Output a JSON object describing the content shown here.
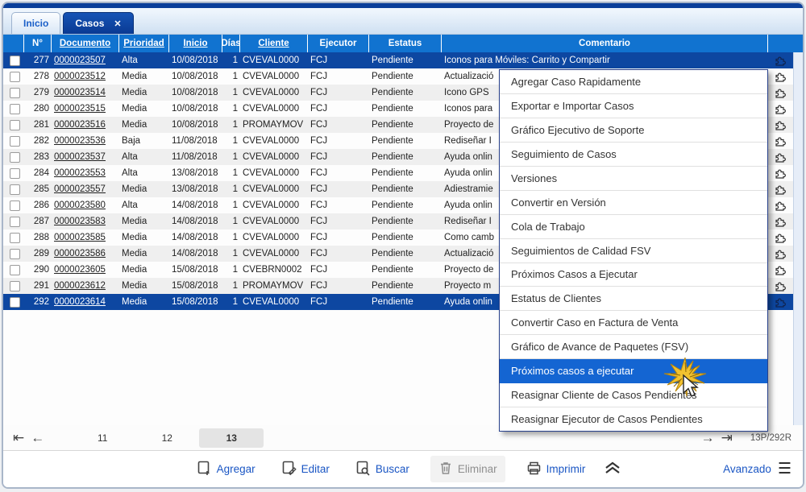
{
  "tabs": [
    {
      "label": "Inicio",
      "active": false
    },
    {
      "label": "Casos",
      "active": true,
      "close_icon": "✕"
    }
  ],
  "table": {
    "headers": [
      {
        "key": "num",
        "label": "N°",
        "sortable": false
      },
      {
        "key": "doc",
        "label": "Documento",
        "sortable": true
      },
      {
        "key": "pri",
        "label": "Prioridad",
        "sortable": true
      },
      {
        "key": "ini",
        "label": "Inicio",
        "sortable": true
      },
      {
        "key": "dia",
        "label": "Días",
        "sortable": false
      },
      {
        "key": "cli",
        "label": "Cliente",
        "sortable": true
      },
      {
        "key": "eje",
        "label": "Ejecutor",
        "sortable": false
      },
      {
        "key": "est",
        "label": "Estatus",
        "sortable": false
      },
      {
        "key": "com",
        "label": "Comentario",
        "sortable": false
      }
    ],
    "rows": [
      {
        "num": "277",
        "doc": "0000023507",
        "pri": "Alta",
        "ini": "10/08/2018",
        "dia": "1",
        "cli": "CVEVAL0000",
        "eje": "FCJ",
        "est": "Pendiente",
        "com": "Iconos para Móviles: Carrito y Compartir",
        "selected": true
      },
      {
        "num": "278",
        "doc": "0000023512",
        "pri": "Media",
        "ini": "10/08/2018",
        "dia": "1",
        "cli": "CVEVAL0000",
        "eje": "FCJ",
        "est": "Pendiente",
        "com": "Actualizació",
        "selected": false
      },
      {
        "num": "279",
        "doc": "0000023514",
        "pri": "Media",
        "ini": "10/08/2018",
        "dia": "1",
        "cli": "CVEVAL0000",
        "eje": "FCJ",
        "est": "Pendiente",
        "com": "Icono GPS",
        "selected": false
      },
      {
        "num": "280",
        "doc": "0000023515",
        "pri": "Media",
        "ini": "10/08/2018",
        "dia": "1",
        "cli": "CVEVAL0000",
        "eje": "FCJ",
        "est": "Pendiente",
        "com": "Iconos para",
        "selected": false
      },
      {
        "num": "281",
        "doc": "0000023516",
        "pri": "Media",
        "ini": "10/08/2018",
        "dia": "1",
        "cli": "PROMAYMOV",
        "eje": "FCJ",
        "est": "Pendiente",
        "com": "Proyecto de",
        "selected": false
      },
      {
        "num": "282",
        "doc": "0000023536",
        "pri": "Baja",
        "ini": "11/08/2018",
        "dia": "1",
        "cli": "CVEVAL0000",
        "eje": "FCJ",
        "est": "Pendiente",
        "com": "Rediseñar I",
        "selected": false
      },
      {
        "num": "283",
        "doc": "0000023537",
        "pri": "Alta",
        "ini": "11/08/2018",
        "dia": "1",
        "cli": "CVEVAL0000",
        "eje": "FCJ",
        "est": "Pendiente",
        "com": "Ayuda onlin",
        "selected": false
      },
      {
        "num": "284",
        "doc": "0000023553",
        "pri": "Alta",
        "ini": "13/08/2018",
        "dia": "1",
        "cli": "CVEVAL0000",
        "eje": "FCJ",
        "est": "Pendiente",
        "com": "Ayuda onlin",
        "selected": false
      },
      {
        "num": "285",
        "doc": "0000023557",
        "pri": "Media",
        "ini": "13/08/2018",
        "dia": "1",
        "cli": "CVEVAL0000",
        "eje": "FCJ",
        "est": "Pendiente",
        "com": "Adiestramie",
        "selected": false
      },
      {
        "num": "286",
        "doc": "0000023580",
        "pri": "Alta",
        "ini": "14/08/2018",
        "dia": "1",
        "cli": "CVEVAL0000",
        "eje": "FCJ",
        "est": "Pendiente",
        "com": "Ayuda onlin",
        "selected": false
      },
      {
        "num": "287",
        "doc": "0000023583",
        "pri": "Media",
        "ini": "14/08/2018",
        "dia": "1",
        "cli": "CVEVAL0000",
        "eje": "FCJ",
        "est": "Pendiente",
        "com": "Rediseñar I",
        "selected": false
      },
      {
        "num": "288",
        "doc": "0000023585",
        "pri": "Media",
        "ini": "14/08/2018",
        "dia": "1",
        "cli": "CVEVAL0000",
        "eje": "FCJ",
        "est": "Pendiente",
        "com": "Como camb",
        "selected": false
      },
      {
        "num": "289",
        "doc": "0000023586",
        "pri": "Media",
        "ini": "14/08/2018",
        "dia": "1",
        "cli": "CVEVAL0000",
        "eje": "FCJ",
        "est": "Pendiente",
        "com": "Actualizació",
        "selected": false
      },
      {
        "num": "290",
        "doc": "0000023605",
        "pri": "Media",
        "ini": "15/08/2018",
        "dia": "1",
        "cli": "CVEBRN0002",
        "eje": "FCJ",
        "est": "Pendiente",
        "com": "Proyecto de",
        "selected": false
      },
      {
        "num": "291",
        "doc": "0000023612",
        "pri": "Media",
        "ini": "15/08/2018",
        "dia": "1",
        "cli": "PROMAYMOV",
        "eje": "FCJ",
        "est": "Pendiente",
        "com": "Proyecto m",
        "selected": false
      },
      {
        "num": "292",
        "doc": "0000023614",
        "pri": "Media",
        "ini": "15/08/2018",
        "dia": "1",
        "cli": "CVEVAL0000",
        "eje": "FCJ",
        "est": "Pendiente",
        "com": "Ayuda onlin",
        "selected": true
      }
    ],
    "row_icon": "puzzle-icon"
  },
  "context_menu": {
    "items": [
      {
        "label": "Agregar Caso Rapidamente",
        "highlighted": false
      },
      {
        "label": "Exportar e Importar Casos",
        "highlighted": false
      },
      {
        "label": "Gráfico Ejecutivo de Soporte",
        "highlighted": false
      },
      {
        "label": "Seguimiento de Casos",
        "highlighted": false
      },
      {
        "label": "Versiones",
        "highlighted": false
      },
      {
        "label": "Convertir en Versión",
        "highlighted": false
      },
      {
        "label": "Cola de Trabajo",
        "highlighted": false
      },
      {
        "label": "Seguimientos de Calidad FSV",
        "highlighted": false
      },
      {
        "label": "Próximos Casos a Ejecutar",
        "highlighted": false
      },
      {
        "label": "Estatus de Clientes",
        "highlighted": false
      },
      {
        "label": "Convertir Caso en Factura de Venta",
        "highlighted": false
      },
      {
        "label": "Gráfico de Avance de Paquetes (FSV)",
        "highlighted": false
      },
      {
        "label": "Próximos casos a ejecutar",
        "highlighted": true
      },
      {
        "label": "Reasignar Cliente de Casos Pendientes",
        "highlighted": false
      },
      {
        "label": "Reasignar Ejecutor de Casos Pendientes",
        "highlighted": false
      }
    ]
  },
  "pagination": {
    "first_icon": "⇤",
    "prev_icon": "←",
    "next_icon": "→",
    "last_icon": "⇥",
    "pages": [
      "11",
      "12",
      "13"
    ],
    "current_page": "13",
    "record_info": "13P/292R"
  },
  "footer": {
    "buttons": [
      {
        "label": "Agregar",
        "icon": "add-document-icon",
        "disabled": false
      },
      {
        "label": "Editar",
        "icon": "edit-document-icon",
        "disabled": false
      },
      {
        "label": "Buscar",
        "icon": "search-document-icon",
        "disabled": false
      },
      {
        "label": "Eliminar",
        "icon": "trash-icon",
        "disabled": true
      },
      {
        "label": "Imprimir",
        "icon": "printer-icon",
        "disabled": false
      }
    ],
    "advanced_label": "Avanzado"
  },
  "colors": {
    "header_blue": "#1173d0",
    "selected_row_blue": "#0d47a1",
    "active_tab_blue": "#0a3a93",
    "menu_highlight_blue": "#1465d2",
    "link_blue": "#1a56c4",
    "alt_row_gray": "#efefef"
  }
}
